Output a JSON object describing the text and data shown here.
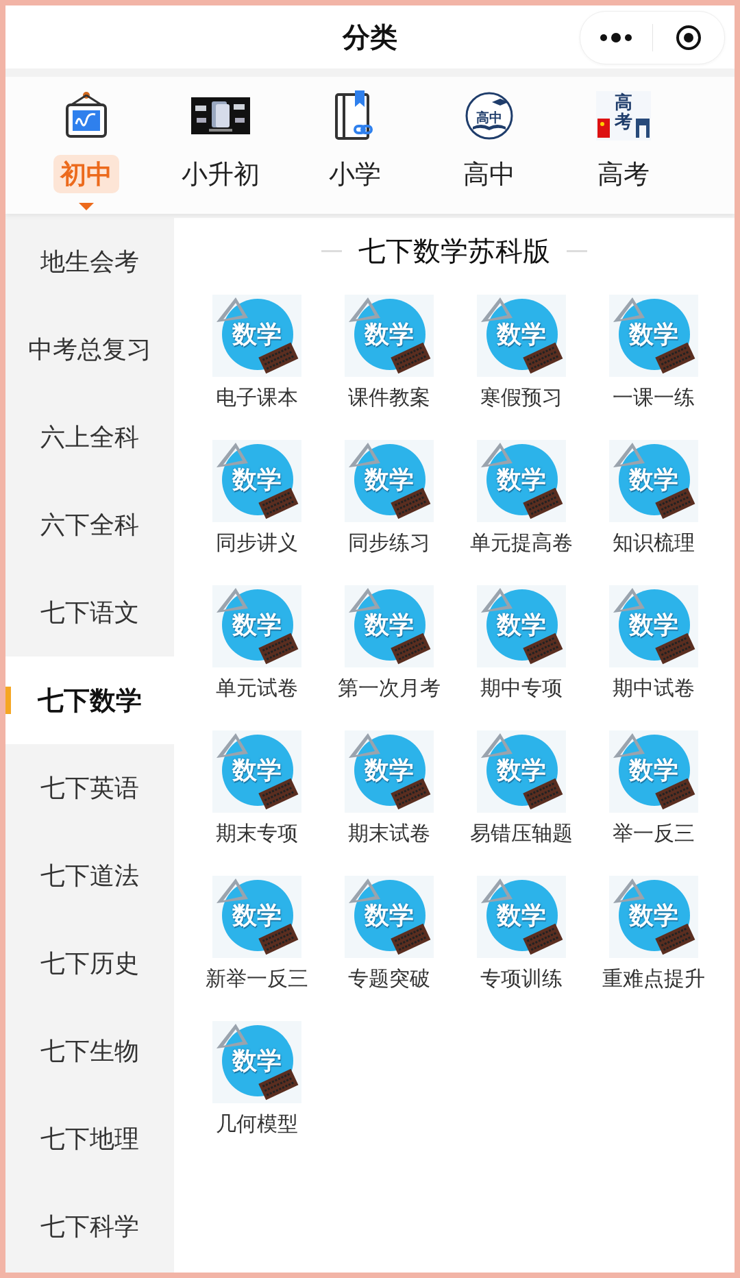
{
  "header": {
    "title": "分类"
  },
  "grade_tabs": [
    {
      "label": "初中",
      "selected": true,
      "kind": "board"
    },
    {
      "label": "小升初",
      "selected": false,
      "kind": "picture"
    },
    {
      "label": "小学",
      "selected": false,
      "kind": "book"
    },
    {
      "label": "高中",
      "selected": false,
      "kind": "badge",
      "icon_text": "高中"
    },
    {
      "label": "高考",
      "selected": false,
      "kind": "emblem",
      "icon_text": "高考"
    }
  ],
  "sidebar": {
    "items": [
      {
        "label": "地生会考",
        "selected": false
      },
      {
        "label": "中考总复习",
        "selected": false
      },
      {
        "label": "六上全科",
        "selected": false
      },
      {
        "label": "六下全科",
        "selected": false
      },
      {
        "label": "七下语文",
        "selected": false
      },
      {
        "label": "七下数学",
        "selected": true
      },
      {
        "label": "七下英语",
        "selected": false
      },
      {
        "label": "七下道法",
        "selected": false
      },
      {
        "label": "七下历史",
        "selected": false
      },
      {
        "label": "七下生物",
        "selected": false
      },
      {
        "label": "七下地理",
        "selected": false
      },
      {
        "label": "七下科学",
        "selected": false
      }
    ]
  },
  "content": {
    "title": "七下数学苏科版",
    "items": [
      {
        "label": "电子课本",
        "icon_text": "数学"
      },
      {
        "label": "课件教案",
        "icon_text": "数学"
      },
      {
        "label": "寒假预习",
        "icon_text": "数学"
      },
      {
        "label": "一课一练",
        "icon_text": "数学"
      },
      {
        "label": "同步讲义",
        "icon_text": "数学"
      },
      {
        "label": "同步练习",
        "icon_text": "数学"
      },
      {
        "label": "单元提高卷",
        "icon_text": "数学"
      },
      {
        "label": "知识梳理",
        "icon_text": "数学"
      },
      {
        "label": "单元试卷",
        "icon_text": "数学"
      },
      {
        "label": "第一次月考",
        "icon_text": "数学"
      },
      {
        "label": "期中专项",
        "icon_text": "数学"
      },
      {
        "label": "期中试卷",
        "icon_text": "数学"
      },
      {
        "label": "期末专项",
        "icon_text": "数学"
      },
      {
        "label": "期末试卷",
        "icon_text": "数学"
      },
      {
        "label": "易错压轴题",
        "icon_text": "数学"
      },
      {
        "label": "举一反三",
        "icon_text": "数学"
      },
      {
        "label": "新举一反三",
        "icon_text": "数学"
      },
      {
        "label": "专题突破",
        "icon_text": "数学"
      },
      {
        "label": "专项训练",
        "icon_text": "数学"
      },
      {
        "label": "重难点提升",
        "icon_text": "数学"
      },
      {
        "label": "几何模型",
        "icon_text": "数学"
      }
    ]
  }
}
